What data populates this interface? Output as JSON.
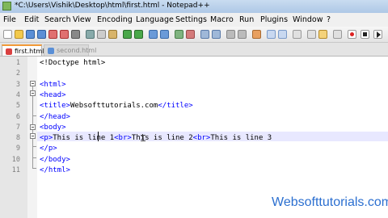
{
  "window": {
    "title": "*C:\\Users\\Vishik\\Desktop\\html\\first.html - Notepad++"
  },
  "menu": [
    "File",
    "Edit",
    "Search",
    "View",
    "Encoding",
    "Language",
    "Settings",
    "Macro",
    "Run",
    "Plugins",
    "Window",
    "?"
  ],
  "tabs": [
    {
      "label": "first.html",
      "active": true
    },
    {
      "label": "second.html",
      "active": false
    }
  ],
  "editor": {
    "line_numbers": [
      "1",
      "2",
      "3",
      "4",
      "5",
      "6",
      "7",
      "8",
      "9",
      "10",
      "11"
    ],
    "lines": [
      [
        {
          "t": "<!Doctype html>",
          "c": "doctype"
        }
      ],
      [],
      [
        {
          "t": "<html>",
          "c": "tag"
        }
      ],
      [
        {
          "t": "<head>",
          "c": "tag"
        }
      ],
      [
        {
          "t": "<title>",
          "c": "tag"
        },
        {
          "t": "Websofttutorials.com",
          "c": "txt"
        },
        {
          "t": "</title>",
          "c": "tag"
        }
      ],
      [
        {
          "t": "</head>",
          "c": "tag"
        }
      ],
      [
        {
          "t": "<body>",
          "c": "tag"
        }
      ],
      [
        {
          "t": "<p>",
          "c": "tag"
        },
        {
          "t": "This is line 1",
          "c": "txt"
        },
        {
          "t": "<br>",
          "c": "tag"
        },
        {
          "t": "This is line 2",
          "c": "txt"
        },
        {
          "t": "<br>",
          "c": "tag"
        },
        {
          "t": "This is line 3",
          "c": "txt"
        }
      ],
      [
        {
          "t": "</p>",
          "c": "tag"
        }
      ],
      [
        {
          "t": "</body>",
          "c": "tag"
        }
      ],
      [
        {
          "t": "</html>",
          "c": "tag"
        }
      ]
    ],
    "current_line": 8
  },
  "watermark": "Websofttutorials.com",
  "colors": {
    "tag": "#0000ff",
    "text": "#000000",
    "current_line": "#e8e8ff",
    "tab_accent": "#f29a38",
    "watermark": "#2b6fd0"
  }
}
